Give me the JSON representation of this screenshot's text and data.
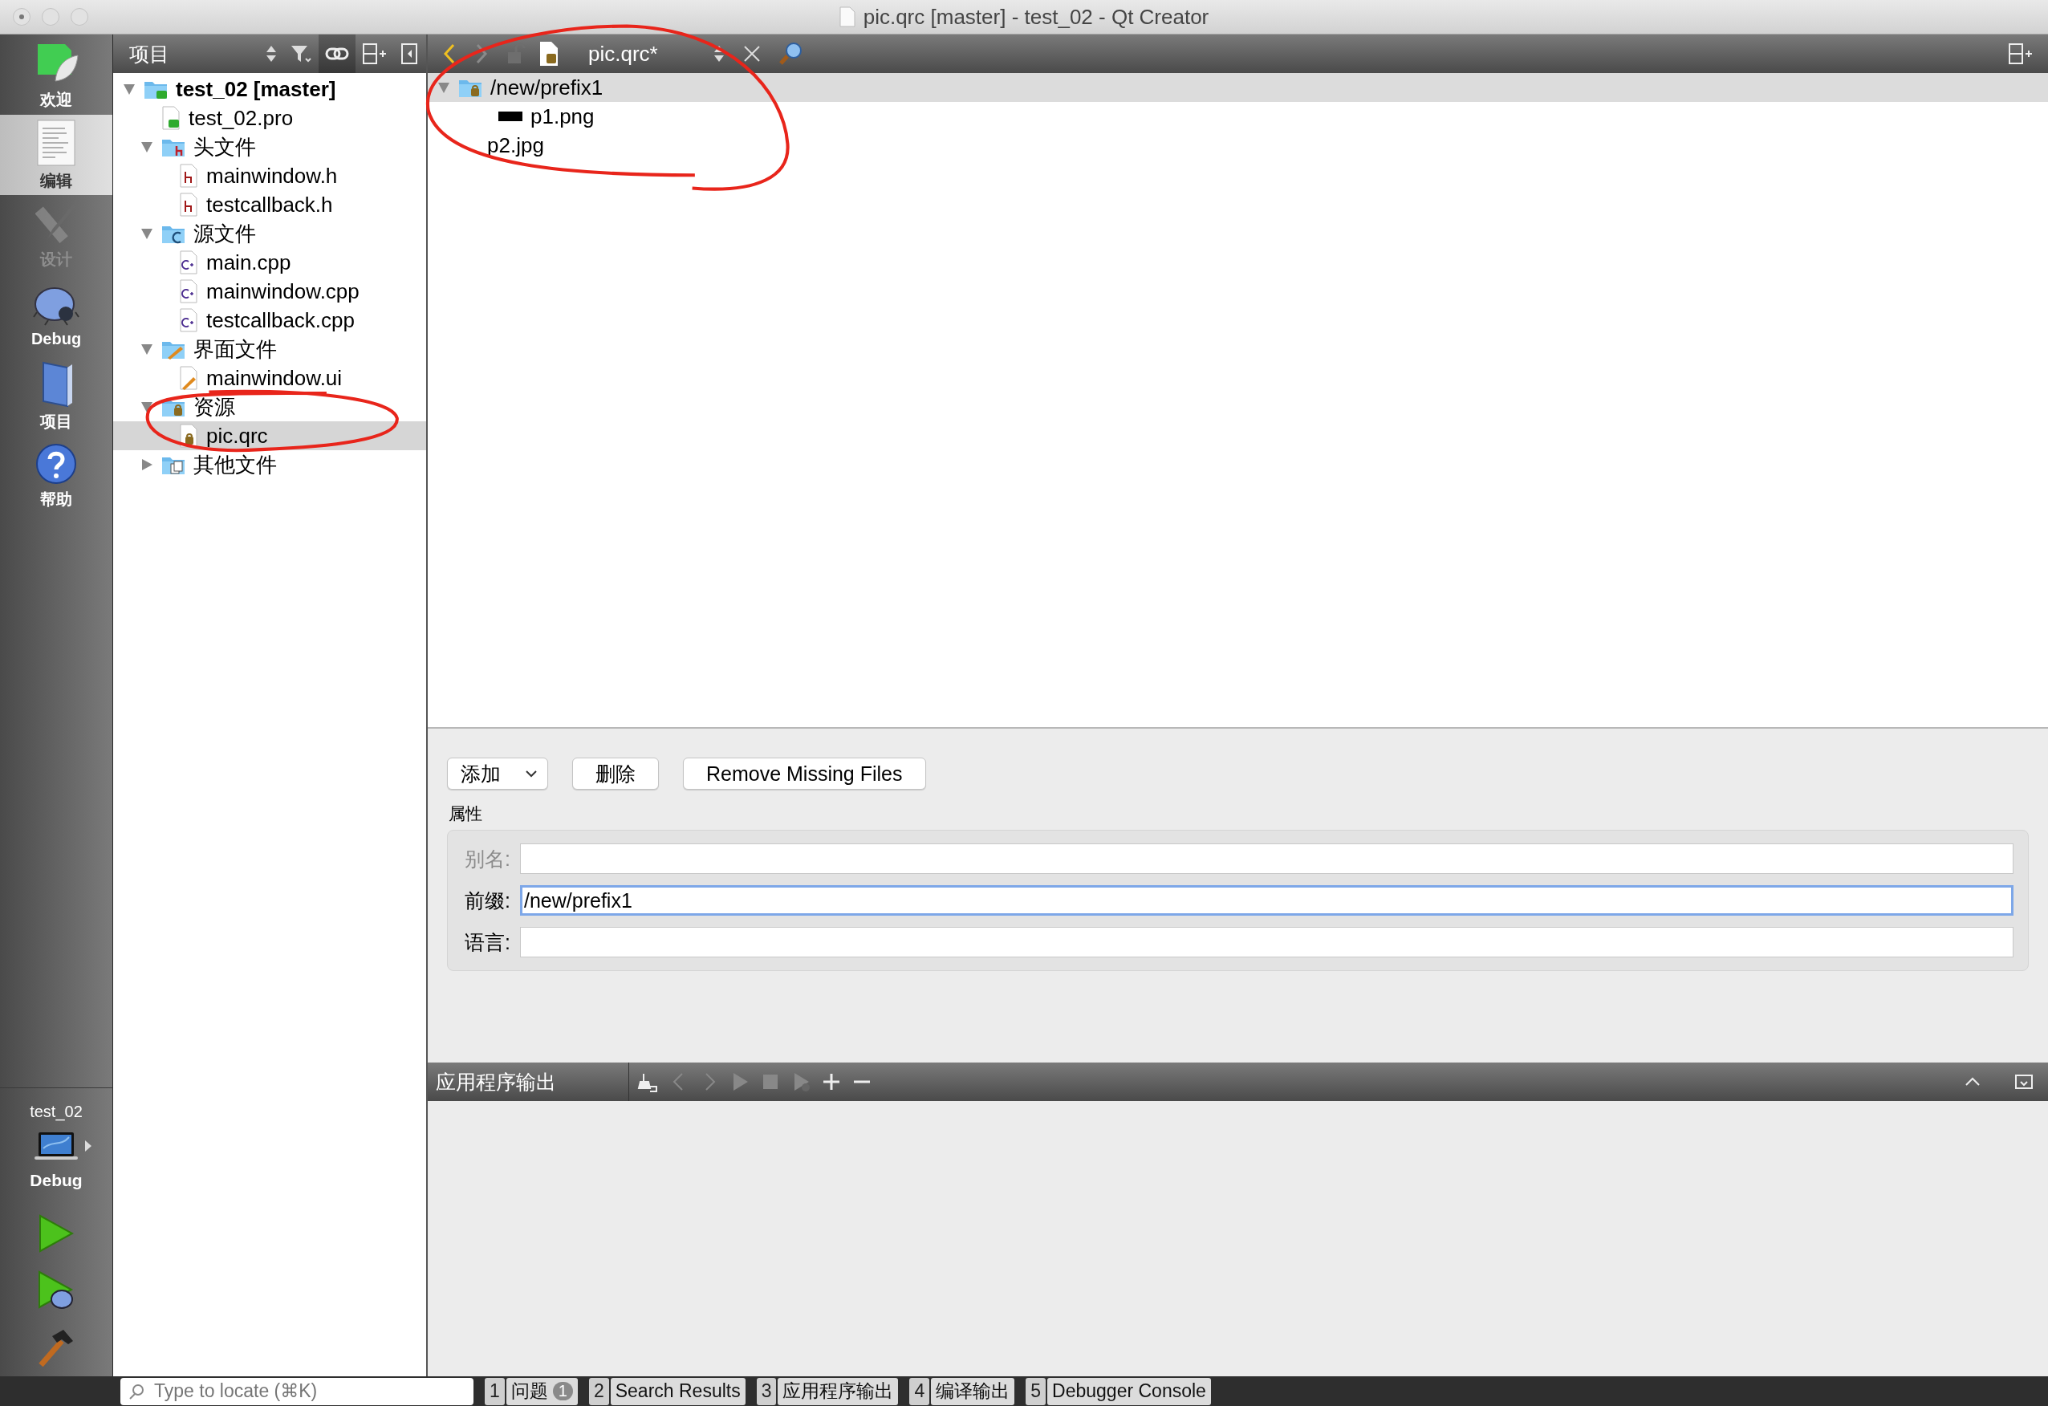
{
  "window": {
    "title": "pic.qrc [master] - test_02 - Qt Creator"
  },
  "mode_bar": {
    "items": [
      {
        "label": "欢迎",
        "kind": "welcome",
        "selected": false,
        "disabled": false
      },
      {
        "label": "编辑",
        "kind": "edit",
        "selected": true,
        "disabled": false
      },
      {
        "label": "设计",
        "kind": "design",
        "selected": false,
        "disabled": true
      },
      {
        "label": "Debug",
        "kind": "debug",
        "selected": false,
        "disabled": false
      },
      {
        "label": "项目",
        "kind": "projects",
        "selected": false,
        "disabled": false
      },
      {
        "label": "帮助",
        "kind": "help",
        "selected": false,
        "disabled": false
      }
    ],
    "target": {
      "project": "test_02",
      "build": "Debug"
    }
  },
  "project_panel": {
    "title": "项目",
    "tree": [
      {
        "label": "test_02 [master]",
        "kind": "project",
        "expanded": true,
        "selected": false,
        "children": [
          {
            "label": "test_02.pro",
            "kind": "pro-file",
            "selected": false
          },
          {
            "label": "头文件",
            "kind": "header-folder",
            "expanded": true,
            "selected": false,
            "children": [
              {
                "label": "mainwindow.h",
                "kind": "header-file",
                "selected": false
              },
              {
                "label": "testcallback.h",
                "kind": "header-file",
                "selected": false
              }
            ]
          },
          {
            "label": "源文件",
            "kind": "source-folder",
            "expanded": true,
            "selected": false,
            "children": [
              {
                "label": "main.cpp",
                "kind": "source-file",
                "selected": false
              },
              {
                "label": "mainwindow.cpp",
                "kind": "source-file",
                "selected": false
              },
              {
                "label": "testcallback.cpp",
                "kind": "source-file",
                "selected": false
              }
            ]
          },
          {
            "label": "界面文件",
            "kind": "form-folder",
            "expanded": true,
            "selected": false,
            "children": [
              {
                "label": "mainwindow.ui",
                "kind": "form-file",
                "selected": false
              }
            ]
          },
          {
            "label": "资源",
            "kind": "resource-folder",
            "expanded": true,
            "selected": false,
            "children": [
              {
                "label": "pic.qrc",
                "kind": "resource-file",
                "selected": true
              }
            ]
          },
          {
            "label": "其他文件",
            "kind": "other-folder",
            "expanded": false,
            "selected": false
          }
        ]
      }
    ]
  },
  "editor": {
    "file": "pic.qrc*",
    "resource_tree": [
      {
        "label": "/new/prefix1",
        "kind": "prefix",
        "expanded": true,
        "selected": true,
        "children": [
          {
            "label": "p1.png",
            "kind": "image",
            "selected": false
          },
          {
            "label": "p2.jpg",
            "kind": "plain",
            "selected": false
          }
        ]
      }
    ],
    "add_button": "添加",
    "remove_button": "删除",
    "remove_missing_button": "Remove Missing Files",
    "properties": {
      "title": "属性",
      "fields": [
        {
          "label": "别名:",
          "disabled": true,
          "focused": false
        },
        {
          "label": "前缀:",
          "value": "/new/prefix1",
          "disabled": false,
          "focused": true
        },
        {
          "label": "语言:",
          "disabled": false,
          "focused": false
        }
      ]
    }
  },
  "output_pane": {
    "title": "应用程序输出"
  },
  "status_bar": {
    "search": {
      "placeholder": "Type to locate (⌘K)"
    },
    "tabs": [
      {
        "number": "1",
        "label": "问题",
        "badge": "1"
      },
      {
        "number": "2",
        "label": "Search Results"
      },
      {
        "number": "3",
        "label": "应用程序输出"
      },
      {
        "number": "4",
        "label": "编译输出"
      },
      {
        "number": "5",
        "label": "Debugger Console"
      }
    ]
  }
}
